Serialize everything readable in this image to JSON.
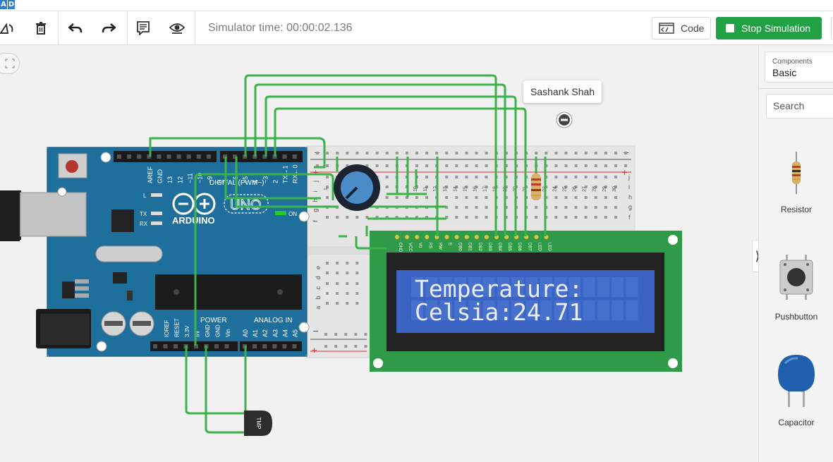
{
  "app": {
    "brand_letters": [
      "A",
      "D"
    ]
  },
  "toolbar": {
    "sim_time": "Simulator time: 00:00:02.136",
    "code_label": "Code",
    "stop_label": "Stop Simulation",
    "tools": [
      "rotate-icon",
      "delete-icon",
      "undo-icon",
      "redo-icon",
      "notes-icon",
      "view-icon"
    ]
  },
  "workspace": {
    "tooltip_user": "Sashank Shah",
    "lcd": {
      "line1": "Temperature:",
      "line2": "Celsia:24.71"
    },
    "arduino": {
      "brand": "ARDUINO",
      "model": "UNO",
      "digital_label": "DIGITAL (PWM~)",
      "power_label": "POWER",
      "analog_label": "ANALOG IN",
      "on_label": "ON",
      "tx_label": "TX",
      "rx_label": "RX",
      "l_label": "L",
      "digital_pins": [
        "AREF",
        "GND",
        "13",
        "12",
        "~11",
        "~10",
        "~9",
        "8",
        "7",
        "~6",
        "~5",
        "4",
        "~3",
        "2",
        "TX→1",
        "RX←0"
      ],
      "power_pins": [
        "IOREF",
        "RESET",
        "3.3V",
        "5V",
        "GND",
        "GND",
        "Vin"
      ],
      "analog_pins": [
        "A0",
        "A1",
        "A2",
        "A3",
        "A4",
        "A5"
      ]
    },
    "sensor_label": "TMP",
    "lcd_pins": [
      "GND",
      "VCC",
      "V0",
      "RS",
      "RW",
      "E",
      "DB0",
      "DB1",
      "DB2",
      "DB3",
      "DB4",
      "DB5",
      "DB6",
      "DB7",
      "LED",
      "LED"
    ],
    "breadboard_cols": [
      "1",
      "2",
      "3",
      "4",
      "5",
      "6",
      "7",
      "8",
      "9",
      "10",
      "11",
      "12",
      "13",
      "14",
      "15",
      "16",
      "17",
      "18",
      "19",
      "20",
      "21",
      "22",
      "23",
      "24",
      "25",
      "26",
      "27",
      "28",
      "29",
      "30"
    ],
    "breadboard_rows_top": [
      "j",
      "i",
      "h",
      "g",
      "f"
    ],
    "breadboard_rows_bottom": [
      "e",
      "d",
      "c",
      "b",
      "a"
    ]
  },
  "panel": {
    "components_key": "Components",
    "components_value": "Basic",
    "search_placeholder": "Search",
    "items": [
      {
        "name": "Resistor"
      },
      {
        "name": "Pushbutton"
      },
      {
        "name": "Capacitor"
      }
    ]
  },
  "colors": {
    "accent": "#21a144",
    "board": "#1f6f9d",
    "lcd_screen": "#3a63c4",
    "wire": "#3bb34a"
  }
}
